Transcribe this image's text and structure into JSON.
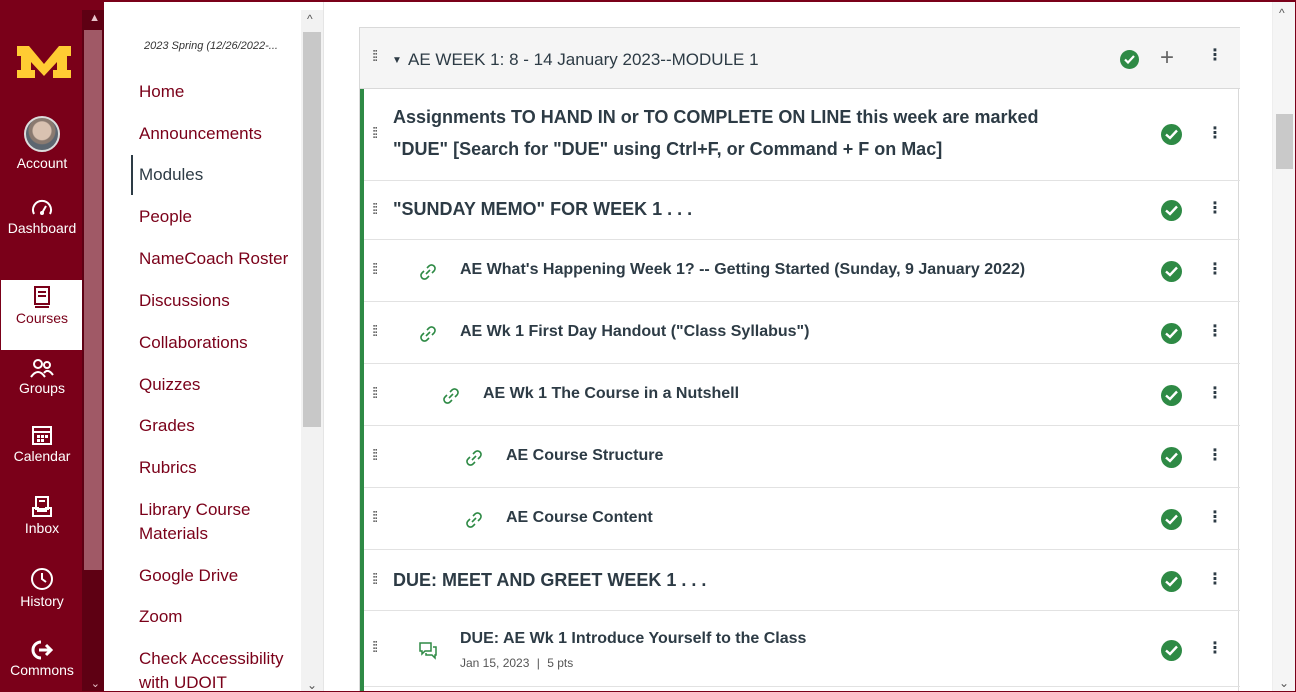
{
  "global_nav": {
    "items": [
      {
        "label": "Account",
        "icon": "avatar"
      },
      {
        "label": "Dashboard",
        "icon": "dashboard-icon"
      },
      {
        "label": "Courses",
        "icon": "courses-icon"
      },
      {
        "label": "Groups",
        "icon": "groups-icon"
      },
      {
        "label": "Calendar",
        "icon": "calendar-icon"
      },
      {
        "label": "Inbox",
        "icon": "inbox-icon"
      },
      {
        "label": "History",
        "icon": "history-icon"
      },
      {
        "label": "Commons",
        "icon": "commons-icon"
      }
    ],
    "brand_color": "#7a0019",
    "logo_color": "#ffcc33"
  },
  "course_nav": {
    "term": "2023 Spring (12/26/2022-...",
    "items": [
      "Home",
      "Announcements",
      "Modules",
      "People",
      "NameCoach Roster",
      "Discussions",
      "Collaborations",
      "Quizzes",
      "Grades",
      "Rubrics",
      "Library Course Materials",
      "Google Drive",
      "Zoom",
      "Check Accessibility with UDOIT"
    ],
    "active": "Modules"
  },
  "module": {
    "title": "AE WEEK 1: 8 - 14 January 2023--MODULE 1",
    "rows": [
      {
        "title_line1": "Assignments TO HAND IN or TO COMPLETE ON LINE this week are marked",
        "title_line2": "\"DUE\" [Search for \"DUE\" using Ctrl+F, or Command + F on Mac]"
      },
      {
        "title": "\"SUNDAY MEMO\" FOR WEEK 1 . . ."
      },
      {
        "title": "AE What's Happening Week 1? -- Getting Started (Sunday, 9 January 2022)"
      },
      {
        "title": "AE Wk 1 First Day Handout (\"Class Syllabus\")"
      },
      {
        "title": "AE Wk 1 The Course in a Nutshell"
      },
      {
        "title": "AE Course Structure"
      },
      {
        "title": "AE Course Content"
      },
      {
        "title": "DUE: MEET AND GREET WEEK 1 . . ."
      },
      {
        "title": "DUE: AE Wk 1 Introduce Yourself to the Class",
        "date": "Jan 15, 2023",
        "sep": "|",
        "points": "5 pts"
      }
    ],
    "accent_color": "#2e8a45"
  }
}
